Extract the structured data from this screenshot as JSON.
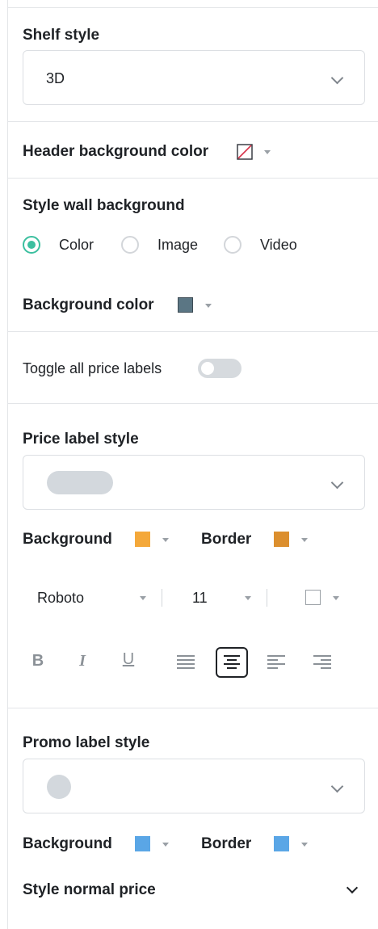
{
  "shelf_style": {
    "label": "Shelf style",
    "value": "3D"
  },
  "header_bg": {
    "label": "Header background color",
    "swatch": "none"
  },
  "wall_bg": {
    "label": "Style wall background",
    "options": [
      "Color",
      "Image",
      "Video"
    ],
    "selected": "Color",
    "bg_color_label": "Background color",
    "bg_color": "#5b7684"
  },
  "price_toggle": {
    "label": "Toggle all price labels",
    "on": false
  },
  "price_label": {
    "label": "Price label style",
    "shape": "pill",
    "background_label": "Background",
    "background_color": "#f4a83a",
    "border_label": "Border",
    "border_color": "#dc8f2e",
    "font": "Roboto",
    "size": "11",
    "text_color": "#ffffff",
    "formatting": [
      "B",
      "I",
      "U"
    ],
    "alignment_selected": "center"
  },
  "promo_label": {
    "label": "Promo label style",
    "shape": "circle",
    "background_label": "Background",
    "background_color": "#5aa6e6",
    "border_label": "Border",
    "border_color": "#5aa6e6"
  },
  "normal_price": {
    "label": "Style normal price"
  },
  "colors": {
    "accent": "#3bbf9f",
    "divider": "#e3e5e8",
    "shape_fill": "#d3d8dd"
  }
}
